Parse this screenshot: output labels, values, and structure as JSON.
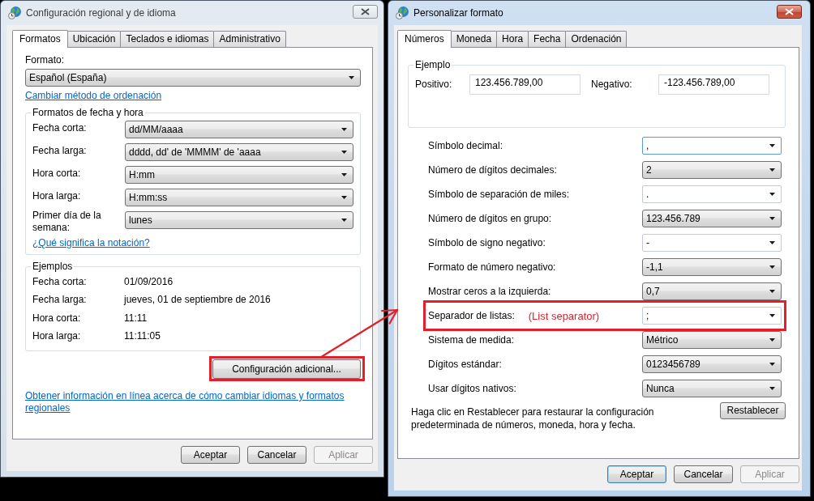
{
  "regional_window": {
    "title": "Configuración regional y de idioma",
    "active": false,
    "tabs": [
      {
        "label": "Formatos",
        "selected": true
      },
      {
        "label": "Ubicación",
        "selected": false
      },
      {
        "label": "Teclados e idiomas",
        "selected": false
      },
      {
        "label": "Administrativo",
        "selected": false
      }
    ],
    "format_label": "Formato:",
    "format_value": "Español (España)",
    "sort_link": "Cambiar método de ordenación",
    "date_time_group": {
      "legend": "Formatos de fecha y hora",
      "rows": [
        {
          "label": "Fecha corta:",
          "value": "dd/MM/aaaa"
        },
        {
          "label": "Fecha larga:",
          "value": "dddd, dd' de 'MMMM' de 'aaaa"
        },
        {
          "label": "Hora corta:",
          "value": "H:mm"
        },
        {
          "label": "Hora larga:",
          "value": "H:mm:ss"
        },
        {
          "label": "Primer día de la semana:",
          "value": "lunes"
        }
      ]
    },
    "notation_link": "¿Qué significa la notación?",
    "examples_group": {
      "legend": "Ejemplos",
      "rows": [
        {
          "label": "Fecha corta:",
          "value": "01/09/2016"
        },
        {
          "label": "Fecha larga:",
          "value": "jueves, 01 de septiembre de 2016"
        },
        {
          "label": "Hora corta:",
          "value": "11:11"
        },
        {
          "label": "Hora larga:",
          "value": "11:11:05"
        }
      ]
    },
    "additional_button": {
      "label": "Configuración adicional...",
      "highlighted": true
    },
    "online_link": "Obtener información en línea acerca de cómo cambiar idiomas y formatos regionales",
    "buttons": [
      {
        "label": "Aceptar",
        "default": false,
        "disabled": false
      },
      {
        "label": "Cancelar",
        "default": false,
        "disabled": false
      },
      {
        "label": "Aplicar",
        "default": false,
        "disabled": true
      }
    ]
  },
  "custom_format_window": {
    "title": "Personalizar formato",
    "active": true,
    "tabs": [
      {
        "label": "Números",
        "selected": true
      },
      {
        "label": "Moneda",
        "selected": false
      },
      {
        "label": "Hora",
        "selected": false
      },
      {
        "label": "Fecha",
        "selected": false
      },
      {
        "label": "Ordenación",
        "selected": false
      }
    ],
    "example_group": {
      "legend": "Ejemplo",
      "positive_label": "Positivo:",
      "positive_value": "123.456.789,00",
      "negative_label": "Negativo:",
      "negative_value": "-123.456.789,00"
    },
    "settings": [
      {
        "label": "Símbolo decimal:",
        "value": ",",
        "kind": "editable",
        "focused": true,
        "highlighted": false
      },
      {
        "label": "Número de dígitos decimales:",
        "value": "2",
        "kind": "dropdown",
        "focused": false,
        "highlighted": false
      },
      {
        "label": "Símbolo de separación de miles:",
        "value": ".",
        "kind": "editable",
        "focused": false,
        "highlighted": false
      },
      {
        "label": "Número de dígitos en grupo:",
        "value": "123.456.789",
        "kind": "dropdown",
        "focused": false,
        "highlighted": false
      },
      {
        "label": "Símbolo de signo negativo:",
        "value": "-",
        "kind": "editable",
        "focused": false,
        "highlighted": false
      },
      {
        "label": "Formato de número negativo:",
        "value": "-1,1",
        "kind": "dropdown",
        "focused": false,
        "highlighted": false
      },
      {
        "label": "Mostrar ceros a la izquierda:",
        "value": "0,7",
        "kind": "dropdown",
        "focused": false,
        "highlighted": false
      },
      {
        "label": "Separador de listas:",
        "value": ";",
        "kind": "editable",
        "focused": false,
        "highlighted": true,
        "annotation": "(List separator)"
      },
      {
        "label": "Sistema de medida:",
        "value": "Métrico",
        "kind": "dropdown",
        "focused": false,
        "highlighted": false
      },
      {
        "label": "Dígitos estándar:",
        "value": "0123456789",
        "kind": "dropdown",
        "focused": false,
        "highlighted": false
      },
      {
        "label": "Usar dígitos nativos:",
        "value": "Nunca",
        "kind": "dropdown",
        "focused": false,
        "highlighted": false
      }
    ],
    "reset_note": "Haga clic en Restablecer para restaurar la configuración predeterminada de números, moneda, hora y fecha.",
    "reset_button": "Restablecer",
    "buttons": [
      {
        "label": "Aceptar",
        "default": true,
        "disabled": false
      },
      {
        "label": "Cancelar",
        "default": false,
        "disabled": false
      },
      {
        "label": "Aplicar",
        "default": false,
        "disabled": true
      }
    ]
  },
  "connector_arrow": true
}
